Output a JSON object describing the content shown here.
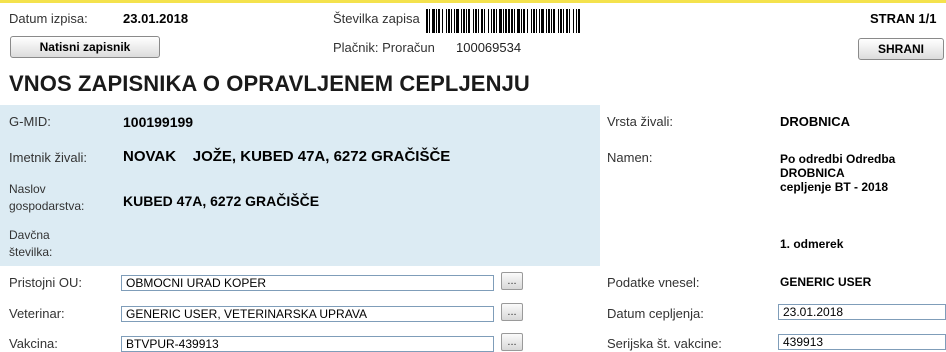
{
  "header": {
    "datum_label": "Datum izpisa:",
    "datum_value": "23.01.2018",
    "stevilka_label": "Številka zapisa",
    "placnik_label": "Plačnik: Proračun",
    "barcode_number": "100069534",
    "page_label": "STRAN 1/1",
    "print_button": "Natisni zapisnik",
    "save_button": "SHRANI"
  },
  "title": "VNOS ZAPISNIKA O OPRAVLJENEM CEPLJENJU",
  "left": {
    "gmid_label": "G-MID:",
    "gmid_value": "100199199",
    "imetnik_label": "Imetnik živali:",
    "imetnik_value": "NOVAK    JOŽE, KUBED 47A, 6272 GRAČIŠČE",
    "naslov_label_1": "Naslov",
    "naslov_label_2": "gospodarstva:",
    "naslov_value": "KUBED 47A, 6272 GRAČIŠČE",
    "davcna_label_1": "Davčna",
    "davcna_label_2": "številka:",
    "ou_label": "Pristojni OU:",
    "ou_value": "OBMOCNI URAD KOPER",
    "veterinar_label": "Veterinar:",
    "veterinar_value": "GENERIC USER, VETERINARSKA UPRAVA",
    "vakcina_label": "Vakcina:",
    "vakcina_value": "BTVPUR-439913",
    "dots_label": "..."
  },
  "right": {
    "vrsta_label": "Vrsta živali:",
    "vrsta_value": "DROBNICA",
    "namen_label": "Namen:",
    "namen_line1": "Po odredbi Odredba",
    "namen_line2": "DROBNICA",
    "namen_line3": "cepljenje BT - 2018",
    "odmerek": "1. odmerek",
    "vnesel_label": "Podatke vnesel:",
    "vnesel_value": "GENERIC USER",
    "datum_cep_label": "Datum cepljenja:",
    "datum_cep_value": "23.01.2018",
    "serijska_label": "Serijska št. vakcine:",
    "serijska_value": "439913"
  },
  "colors": {
    "panel": "#dcebf3",
    "accent_bar": "#f4e24d"
  }
}
